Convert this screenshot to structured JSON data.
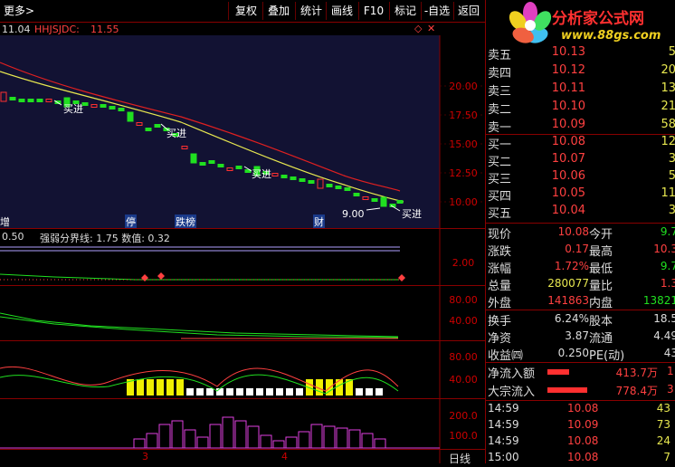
{
  "toolbar": {
    "more": "更多>",
    "buttons": [
      "复权",
      "叠加",
      "统计",
      "画线",
      "F10",
      "标记",
      "-自选",
      "返回"
    ]
  },
  "main_chart": {
    "header_price": "11.04",
    "indicator_name": "HHJSJDC:",
    "indicator_value": "11.55",
    "y_ticks": [
      "20.00",
      "17.50",
      "15.00",
      "12.50",
      "10.00"
    ],
    "annotations": [
      "买进",
      "买进",
      "买进",
      "买进"
    ],
    "low_label": "9.00",
    "bottom_tags": [
      "停",
      "跌榜",
      "财",
      "增"
    ],
    "colors": {
      "ma_red": "#e02020",
      "ma_yellow": "#e8e850",
      "up": "#ff3030",
      "down": "#20e020"
    }
  },
  "indicator1": {
    "left_value": "0.50",
    "label": "强弱分界线: 1.75  数值: 0.32",
    "y_tick": "2.00"
  },
  "indicator2": {
    "y_ticks": [
      "80.00",
      "40.00"
    ]
  },
  "indicator3": {
    "y_ticks": [
      "80.00",
      "40.00"
    ]
  },
  "indicator4": {
    "y_ticks": [
      "200.0",
      "100.0"
    ]
  },
  "x_axis": {
    "labels": [
      "3",
      "4"
    ],
    "period": "日线"
  },
  "logo": {
    "text": "分析家公式网",
    "url": "www.88gs.com"
  },
  "quote": {
    "asks": [
      {
        "label": "卖五",
        "price": "10.13",
        "vol": "5"
      },
      {
        "label": "卖四",
        "price": "10.12",
        "vol": "20"
      },
      {
        "label": "卖三",
        "price": "10.11",
        "vol": "13"
      },
      {
        "label": "卖二",
        "price": "10.10",
        "vol": "21"
      },
      {
        "label": "卖一",
        "price": "10.09",
        "vol": "58"
      }
    ],
    "bids": [
      {
        "label": "买一",
        "price": "10.08",
        "vol": "12"
      },
      {
        "label": "买二",
        "price": "10.07",
        "vol": "3"
      },
      {
        "label": "买三",
        "price": "10.06",
        "vol": "5"
      },
      {
        "label": "买四",
        "price": "10.05",
        "vol": "11"
      },
      {
        "label": "买五",
        "price": "10.04",
        "vol": "3"
      }
    ],
    "stats": [
      {
        "l1": "现价",
        "v1": "10.08",
        "c1": "#ff4040",
        "l2": "今开",
        "v2": "9.7",
        "c2": "#20e020"
      },
      {
        "l1": "涨跌",
        "v1": "0.17",
        "c1": "#ff4040",
        "l2": "最高",
        "v2": "10.3",
        "c2": "#ff4040"
      },
      {
        "l1": "涨幅",
        "v1": "1.72%",
        "c1": "#ff4040",
        "l2": "最低",
        "v2": "9.7",
        "c2": "#20e020"
      },
      {
        "l1": "总量",
        "v1": "280077",
        "c1": "#e8e850",
        "l2": "量比",
        "v2": "1.3",
        "c2": "#ff4040"
      },
      {
        "l1": "外盘",
        "v1": "141863",
        "c1": "#ff4040",
        "l2": "内盘",
        "v2": "13821",
        "c2": "#20e020"
      }
    ],
    "stats2": [
      {
        "l1": "换手",
        "v1": "6.24%",
        "c1": "#ddd",
        "l2": "股本",
        "v2": "18.5",
        "c2": "#ddd"
      },
      {
        "l1": "净资",
        "v1": "3.87",
        "c1": "#ddd",
        "l2": "流通",
        "v2": "4.49",
        "c2": "#ddd"
      },
      {
        "l1": "收益㈣",
        "v1": "0.250",
        "c1": "#ddd",
        "l2": "PE(动)",
        "v2": "43",
        "c2": "#ddd"
      }
    ],
    "flows": [
      {
        "label": "净流入额",
        "value": "413.7万",
        "extra": "1"
      },
      {
        "label": "大宗流入",
        "value": "778.4万",
        "extra": "3"
      }
    ],
    "ticks": [
      {
        "time": "14:59",
        "price": "10.08",
        "vol": "43"
      },
      {
        "time": "14:59",
        "price": "10.09",
        "vol": "73"
      },
      {
        "time": "14:59",
        "price": "10.08",
        "vol": "24"
      },
      {
        "time": "15:00",
        "price": "10.08",
        "vol": "7"
      }
    ]
  }
}
